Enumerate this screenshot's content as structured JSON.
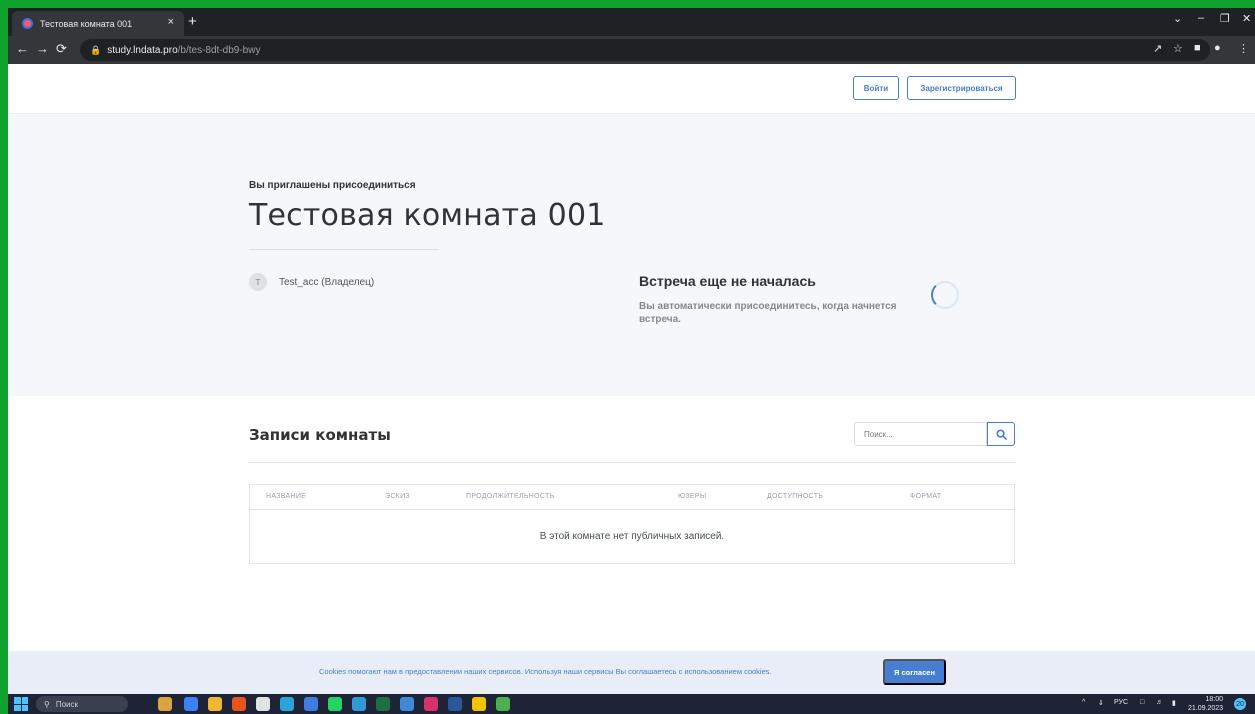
{
  "browser": {
    "tab_title": "Тестовая комната 001",
    "tab_close": "×",
    "new_tab": "+",
    "url_host": "study.lndata.pro",
    "url_path": "/b/tes-8dt-db9-bwy",
    "icons": [
      "back-icon",
      "forward-icon",
      "reload-icon",
      "lock-icon",
      "share-icon",
      "star-icon",
      "sidepanel-icon",
      "profile-icon",
      "menu-icon"
    ]
  },
  "header": {
    "login_label": "Войти",
    "register_label": "Зарегистрироваться"
  },
  "hero": {
    "invited_text": "Вы приглашены присоединиться",
    "room_title": "Тестовая комната 001",
    "owner_initial": "T",
    "owner_name": "Test_acc (Владелец)",
    "meeting_title": "Встреча еще не началась",
    "meeting_subtitle": "Вы автоматически присоединитесь, когда начнется встреча."
  },
  "recordings": {
    "title": "Записи комнаты",
    "search_placeholder": "Поиск...",
    "columns": [
      "НАЗВАНИЕ",
      "ЭСКИЗ",
      "ПРОДОЛЖИТЕЛЬНОСТЬ",
      "ЮЗЕРЫ",
      "ДОСТУПНОСТЬ",
      "ФОРМАТ"
    ],
    "empty_message": "В этой комнате нет публичных записей."
  },
  "cookie": {
    "text": "Cookies помогают нам в предоставлении наших сервисов. Используя наши сервисы Вы соглашаетесь с использованием cookies.",
    "accept_label": "Я согласен"
  },
  "taskbar": {
    "search_label": "Поиск",
    "lang": "РУС",
    "time": "18:00",
    "date": "21.09.2023",
    "notification_count": "20"
  },
  "colors": {
    "accent": "#467fcf",
    "hero_bg": "#f5f7fb",
    "cookie_bg": "#e8edf8",
    "frame_border": "#0ea12b"
  }
}
